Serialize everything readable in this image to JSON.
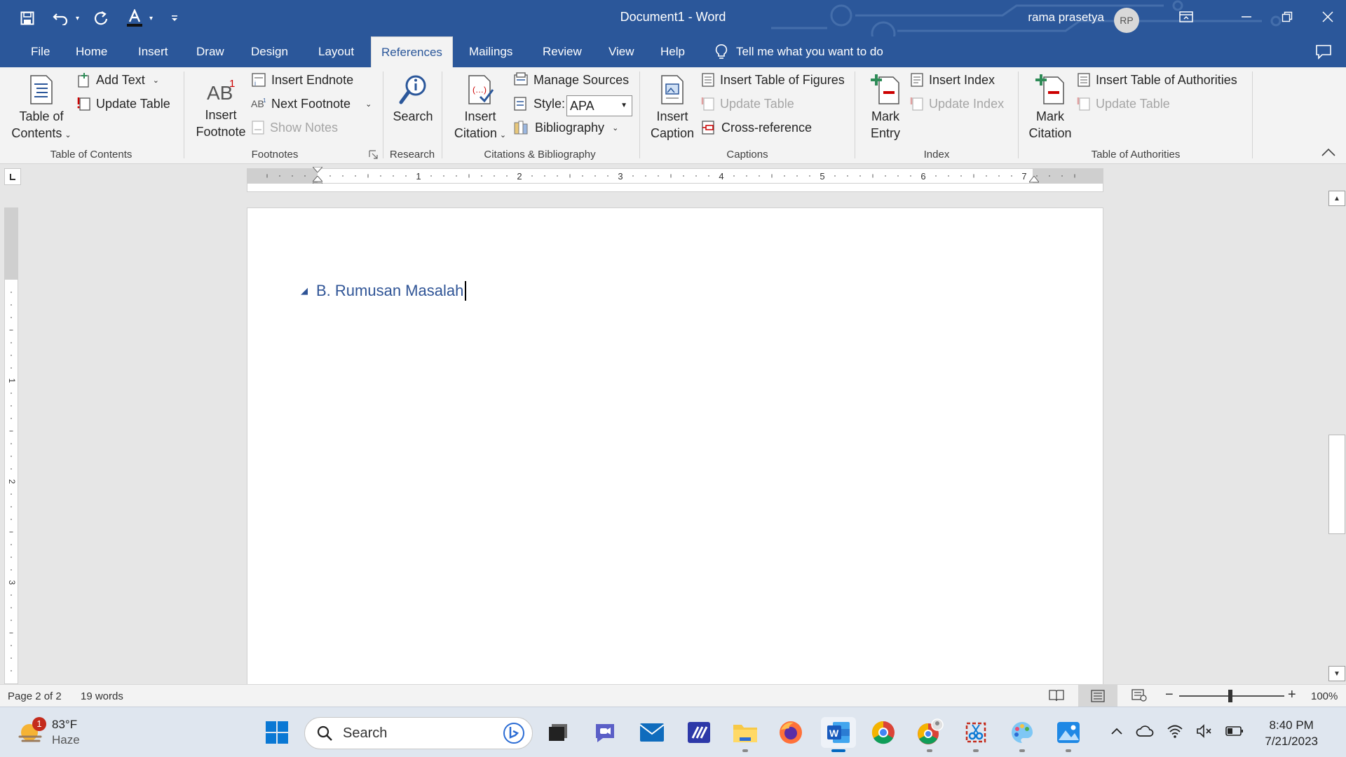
{
  "window": {
    "title": "Document1  -  Word",
    "user_name": "rama prasetya",
    "user_initials": "RP"
  },
  "tabs": [
    {
      "label": "File"
    },
    {
      "label": "Home"
    },
    {
      "label": "Insert"
    },
    {
      "label": "Draw"
    },
    {
      "label": "Design"
    },
    {
      "label": "Layout"
    },
    {
      "label": "References"
    },
    {
      "label": "Mailings"
    },
    {
      "label": "Review"
    },
    {
      "label": "View"
    },
    {
      "label": "Help"
    }
  ],
  "active_tab": "References",
  "tell_me": "Tell me what you want to do",
  "ribbon": {
    "toc": {
      "group": "Table of Contents",
      "table_of_contents_1": "Table of",
      "table_of_contents_2": "Contents",
      "add_text": "Add Text",
      "update_table": "Update Table"
    },
    "footnotes": {
      "group": "Footnotes",
      "insert_footnote_1": "Insert",
      "insert_footnote_2": "Footnote",
      "insert_endnote": "Insert Endnote",
      "next_footnote": "Next Footnote",
      "show_notes": "Show Notes"
    },
    "research": {
      "group": "Research",
      "search": "Search"
    },
    "citations": {
      "group": "Citations & Bibliography",
      "insert_citation_1": "Insert",
      "insert_citation_2": "Citation",
      "manage_sources": "Manage Sources",
      "style_label": "Style:",
      "style_value": "APA",
      "bibliography": "Bibliography"
    },
    "captions": {
      "group": "Captions",
      "insert_caption_1": "Insert",
      "insert_caption_2": "Caption",
      "insert_table_of_figures": "Insert Table of Figures",
      "update_table": "Update Table",
      "cross_reference": "Cross-reference"
    },
    "index": {
      "group": "Index",
      "mark_entry_1": "Mark",
      "mark_entry_2": "Entry",
      "insert_index": "Insert Index",
      "update_index": "Update Index"
    },
    "authorities": {
      "group": "Table of Authorities",
      "mark_citation_1": "Mark",
      "mark_citation_2": "Citation",
      "insert_table_of_authorities": "Insert Table of Authorities",
      "update_table": "Update Table"
    }
  },
  "ruler": {
    "numbers": [
      "1",
      "2",
      "3",
      "4",
      "5",
      "6",
      "7"
    ],
    "vertical_numbers": [
      "1",
      "2",
      "3"
    ]
  },
  "document": {
    "heading": "B. Rumusan Masalah"
  },
  "status": {
    "page": "Page 2 of 2",
    "words": "19 words",
    "zoom": "100%",
    "zoom_level_percent": 100
  },
  "taskbar": {
    "weather_temp": "83°F",
    "weather_desc": "Haze",
    "weather_badge": "1",
    "search_placeholder": "Search",
    "time": "8:40 PM",
    "date": "7/21/2023"
  },
  "colors": {
    "word_blue": "#2b579a",
    "heading_blue": "#2f5496",
    "ribbon_bg": "#f3f3f3"
  }
}
